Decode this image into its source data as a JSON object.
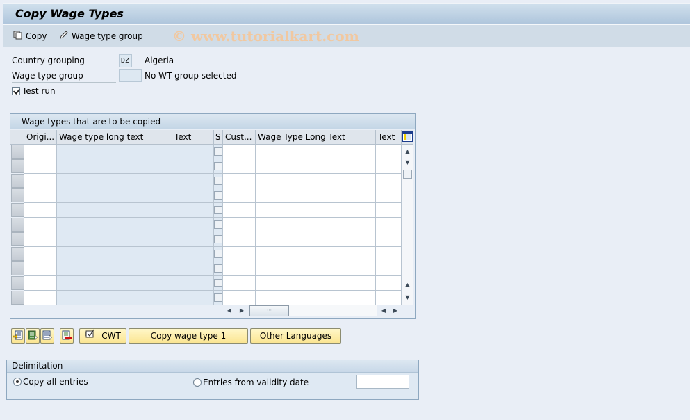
{
  "window": {
    "title": "Copy Wage Types"
  },
  "toolbar": {
    "copy_label": "Copy",
    "copy_icon": "copy-icon",
    "wage_type_group_label": "Wage type group",
    "wage_type_group_icon": "pencil-icon",
    "watermark": "© www.tutorialkart.com"
  },
  "selection": {
    "country_grouping": {
      "label": "Country grouping",
      "value": "DZ",
      "description": "Algeria"
    },
    "wage_type_group": {
      "label": "Wage type group",
      "value": "",
      "description": "No WT group selected"
    },
    "test_run": {
      "label": "Test run",
      "checked": true
    }
  },
  "table": {
    "title": "Wage types that are to be copied",
    "columns": [
      {
        "label": "Origi..."
      },
      {
        "label": "Wage type long text"
      },
      {
        "label": "Text"
      },
      {
        "label": "S"
      },
      {
        "label": "Cust..."
      },
      {
        "label": "Wage Type Long Text"
      },
      {
        "label": "Text"
      }
    ],
    "settings_icon": "table-settings-icon",
    "row_count_visible": 11,
    "rows": []
  },
  "actions": {
    "icon_buttons": [
      {
        "name": "insert-row-icon"
      },
      {
        "name": "select-all-icon"
      },
      {
        "name": "deselect-all-icon"
      },
      {
        "name": "delete-row-icon"
      }
    ],
    "cwt_label": "CWT",
    "copy_wage_type_label": "Copy wage type 1",
    "other_languages_label": "Other Languages"
  },
  "delimitation": {
    "title": "Delimitation",
    "copy_all_label": "Copy all entries",
    "copy_all_selected": true,
    "validity_label": "Entries from validity date",
    "validity_selected": false,
    "validity_date": ""
  }
}
